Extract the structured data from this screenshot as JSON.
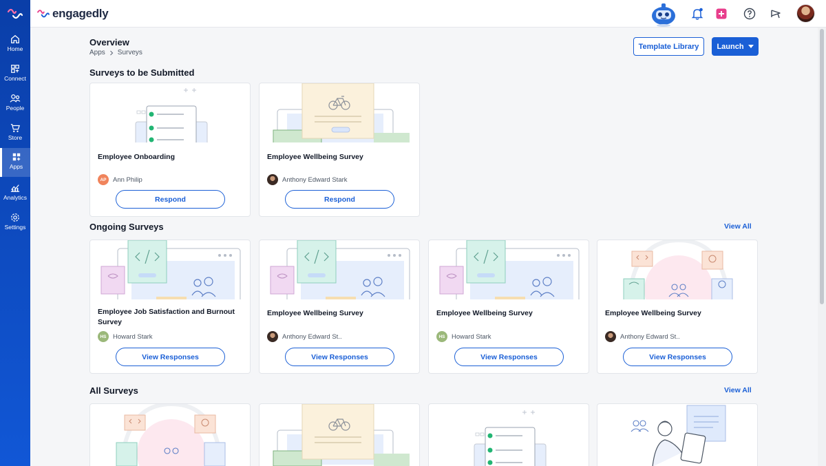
{
  "brand": {
    "name": "engagedly"
  },
  "sidebar": {
    "items": [
      {
        "label": "Home",
        "icon": "home-icon"
      },
      {
        "label": "Connect",
        "icon": "connect-icon"
      },
      {
        "label": "People",
        "icon": "people-icon"
      },
      {
        "label": "Store",
        "icon": "cart-icon"
      },
      {
        "label": "Apps",
        "icon": "apps-icon",
        "active": true
      },
      {
        "label": "Analytics",
        "icon": "analytics-icon"
      },
      {
        "label": "Settings",
        "icon": "gear-icon"
      }
    ]
  },
  "header": {
    "title": "Overview",
    "breadcrumb": [
      "Apps",
      "Surveys"
    ],
    "template_library_label": "Template Library",
    "launch_label": "Launch"
  },
  "sections": {
    "to_submit": {
      "title": "Surveys to be Submitted",
      "cards": [
        {
          "title": "Employee Onboarding",
          "owner": "Ann Philip",
          "owner_initials": "AP",
          "action": "Respond"
        },
        {
          "title": "Employee Wellbeing Survey",
          "owner": "Anthony Edward Stark",
          "action": "Respond"
        }
      ]
    },
    "ongoing": {
      "title": "Ongoing Surveys",
      "view_all": "View All",
      "cards": [
        {
          "title": "Employee Job Satisfaction and Burnout Survey",
          "owner": "Howard Stark",
          "owner_initials": "HS",
          "action": "View Responses"
        },
        {
          "title": "Employee Wellbeing Survey",
          "owner": "Anthony Edward St..",
          "action": "View Responses"
        },
        {
          "title": "Employee Wellbeing Survey",
          "owner": "Howard Stark",
          "owner_initials": "HS",
          "action": "View Responses"
        },
        {
          "title": "Employee Wellbeing Survey",
          "owner": "Anthony Edward St..",
          "action": "View Responses"
        }
      ]
    },
    "all": {
      "title": "All Surveys",
      "view_all": "View All"
    }
  },
  "colors": {
    "primary": "#1a5fd6",
    "sidebar": "#0a3ea8",
    "ap_avatar": "#f0845c",
    "hs_avatar": "#9bb87a",
    "notify_pink": "#e83e8c"
  }
}
